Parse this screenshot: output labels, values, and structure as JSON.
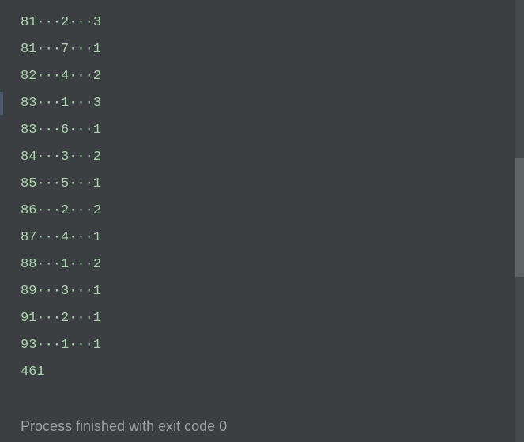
{
  "output": {
    "rows": [
      [
        "81",
        "2",
        "3"
      ],
      [
        "81",
        "7",
        "1"
      ],
      [
        "82",
        "4",
        "2"
      ],
      [
        "83",
        "1",
        "3"
      ],
      [
        "83",
        "6",
        "1"
      ],
      [
        "84",
        "3",
        "2"
      ],
      [
        "85",
        "5",
        "1"
      ],
      [
        "86",
        "2",
        "2"
      ],
      [
        "87",
        "4",
        "1"
      ],
      [
        "88",
        "1",
        "2"
      ],
      [
        "89",
        "3",
        "1"
      ],
      [
        "91",
        "2",
        "1"
      ],
      [
        "93",
        "1",
        "1"
      ]
    ],
    "final_value": "461",
    "separator": "···"
  },
  "process_message": "Process finished with exit code 0"
}
